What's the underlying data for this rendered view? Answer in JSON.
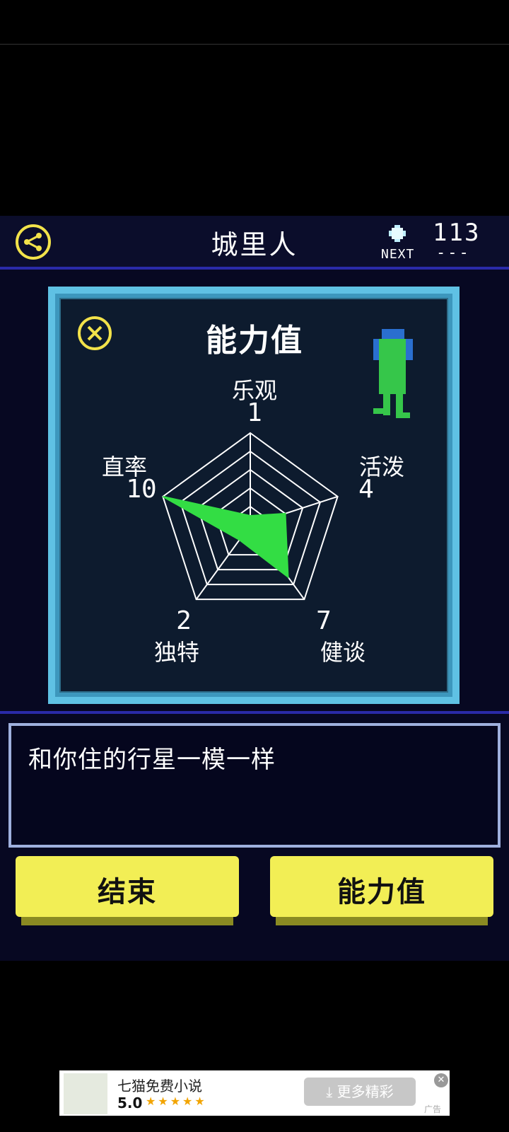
{
  "header": {
    "title": "城里人",
    "next_label": "NEXT",
    "points": "113",
    "next_value": "---"
  },
  "panel": {
    "title": "能力值",
    "stats": [
      {
        "label": "乐观",
        "value": "1"
      },
      {
        "label": "活泼",
        "value": "4"
      },
      {
        "label": "健谈",
        "value": "7"
      },
      {
        "label": "独特",
        "value": "2"
      },
      {
        "label": "直率",
        "value": "10"
      }
    ],
    "max_value": 10
  },
  "message": {
    "text": "和你住的行星一模一样"
  },
  "buttons": {
    "end": "结束",
    "stats": "能力值"
  },
  "ad": {
    "app_name": "七猫免费小说",
    "rating": "5.0",
    "cta": "更多精彩",
    "tag": "广告"
  },
  "colors": {
    "accent_yellow": "#f2ee55",
    "radar_fill": "#33dd44",
    "panel_border": "#5fc1e4"
  }
}
